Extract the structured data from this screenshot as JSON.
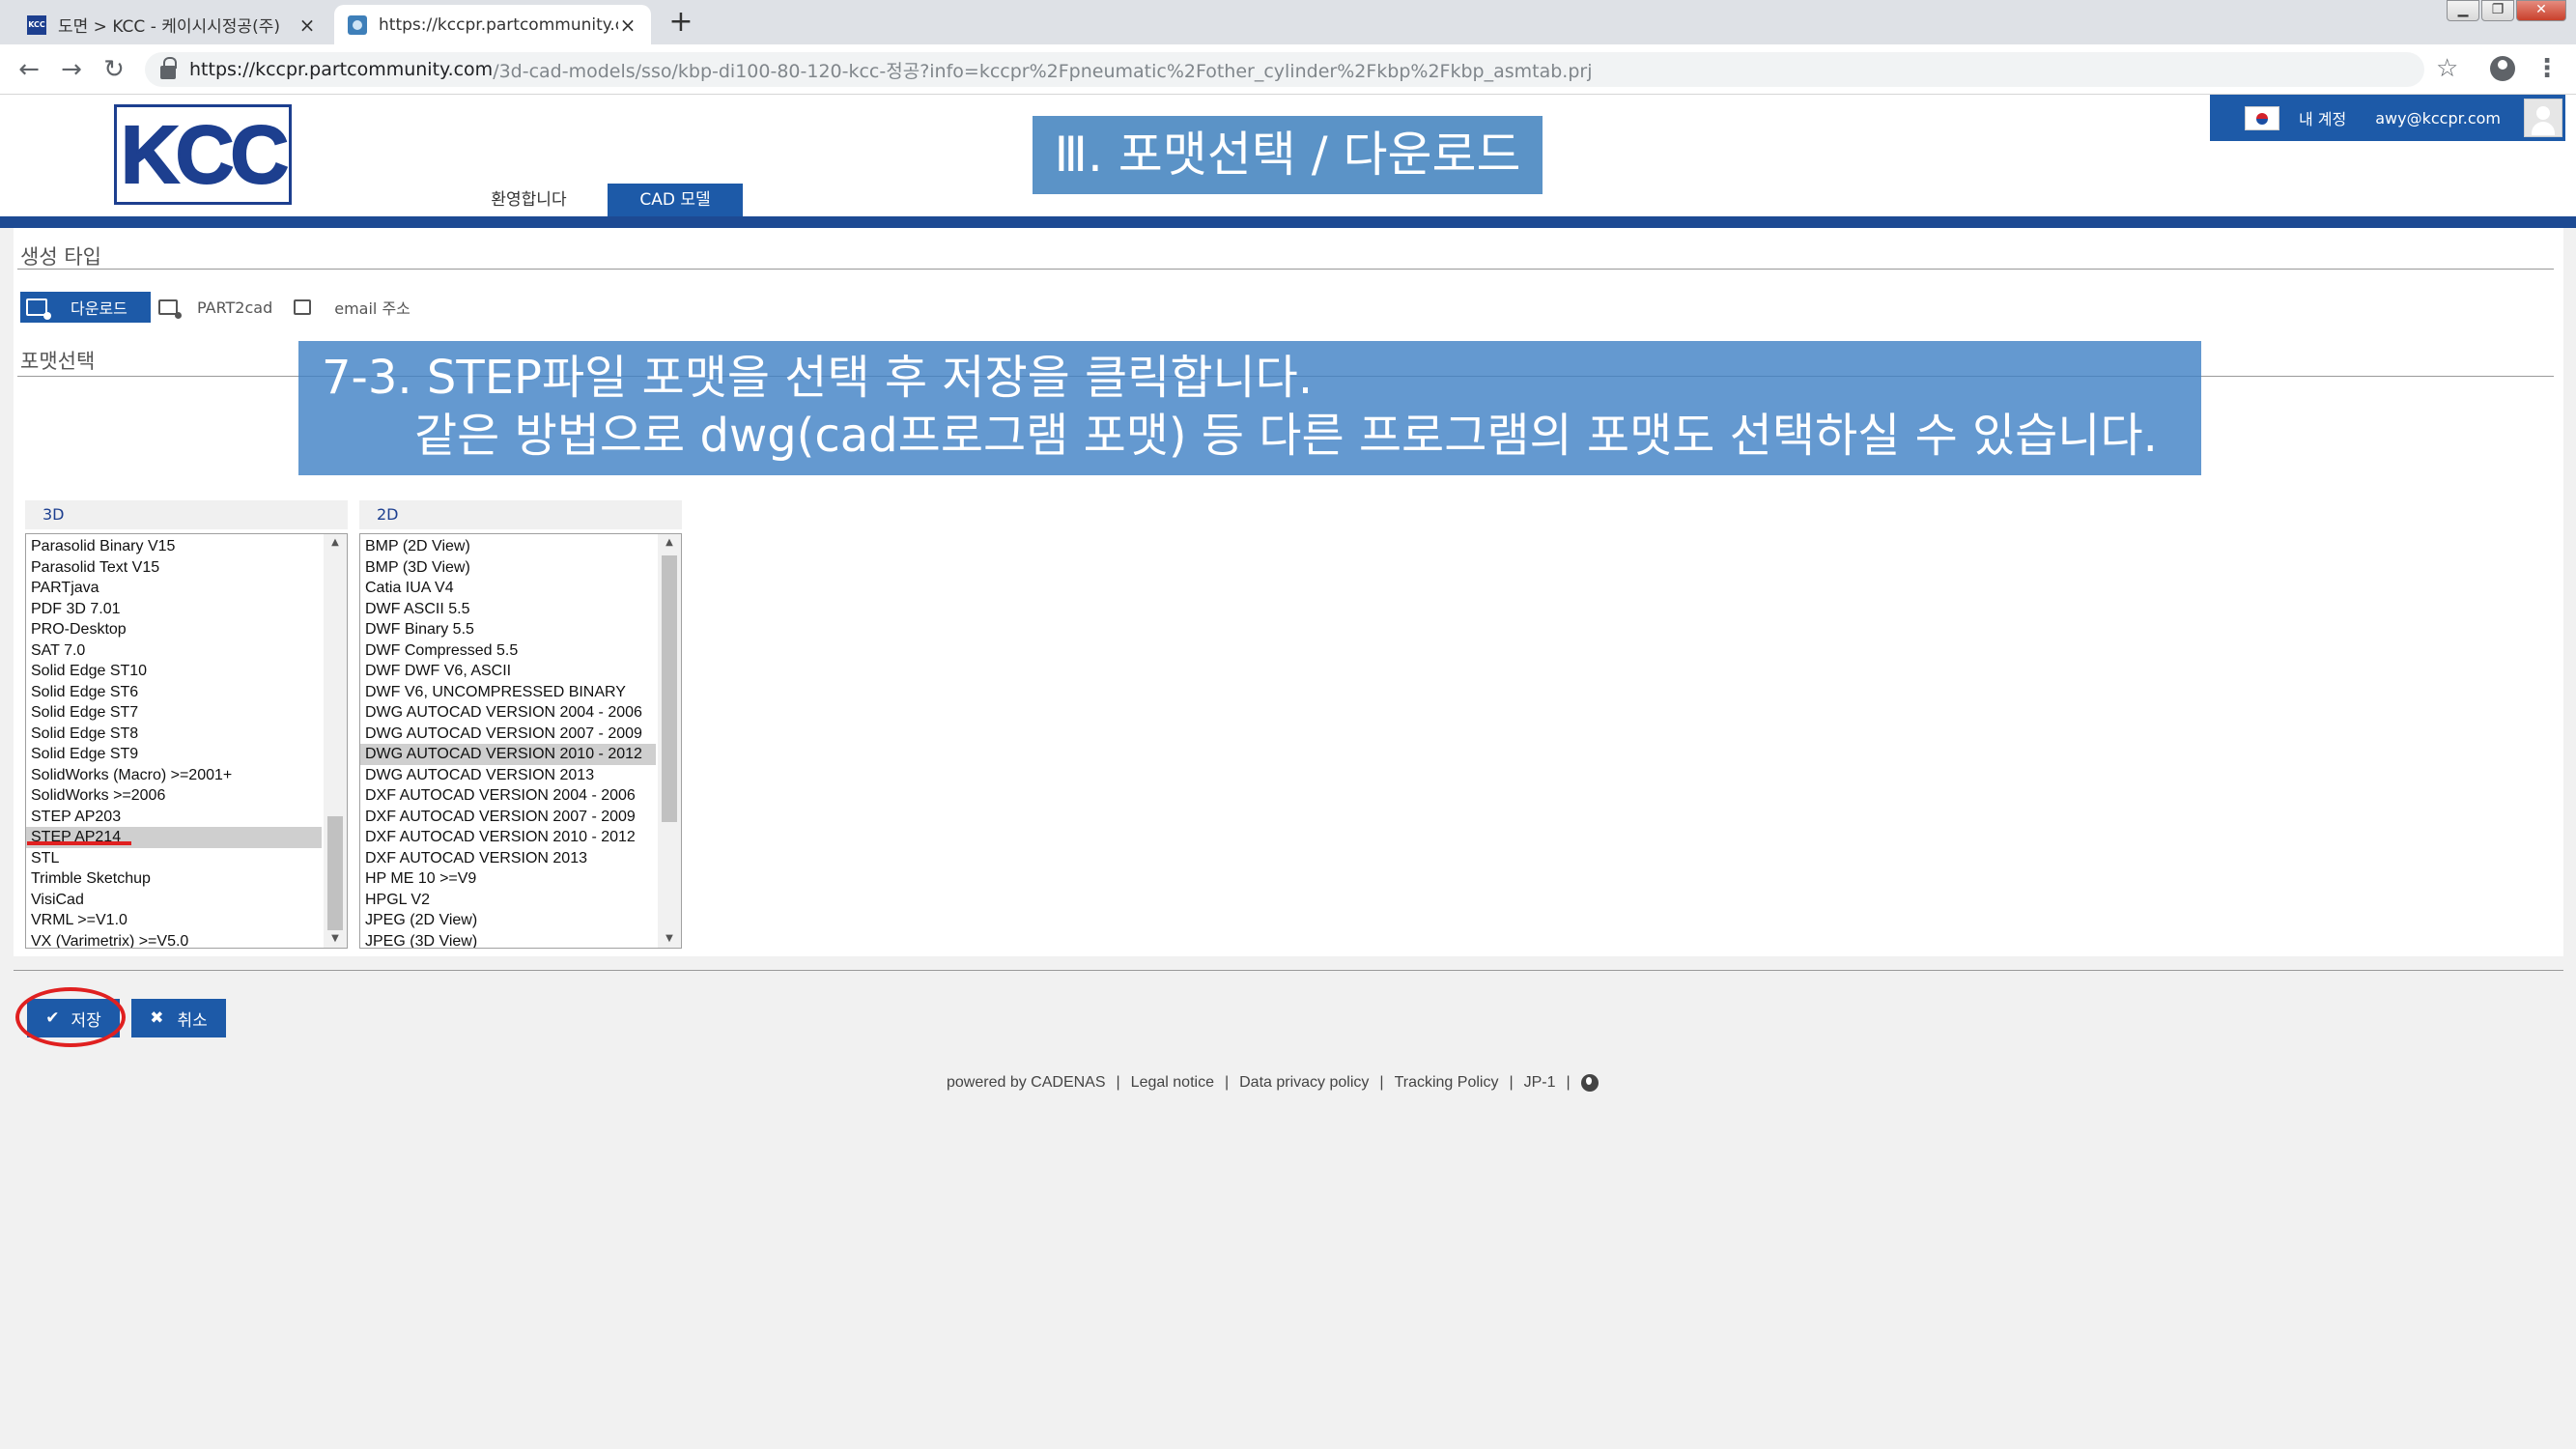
{
  "browser": {
    "tabs": [
      {
        "title": "도면 > KCC - 케이시시정공(주)",
        "active": false
      },
      {
        "title": "https://kccpr.partcommunity.co",
        "active": true
      }
    ],
    "new_tab": "+",
    "url_host": "https://kccpr.partcommunity.com",
    "url_path": "/3d-cad-models/sso/kbp-di100-80-120-kcc-정공?info=kccpr%2Fpneumatic%2Fother_cylinder%2Fkbp%2Fkbp_asmtab.prj"
  },
  "header": {
    "logo_text": "KCC",
    "nav": [
      "환영합니다",
      "CAD 모델"
    ],
    "title": "Ⅲ. 포맷선택 / 다운로드",
    "user": {
      "account": "내 계정",
      "email": "awy@kccpr.com"
    }
  },
  "form": {
    "generation_type_label": "생성 타입",
    "types": [
      "다운로드",
      "PART2cad",
      "email 주소"
    ],
    "format_label": "포맷선택",
    "list_3d": {
      "header": "3D",
      "items": [
        "Parasolid Binary V15",
        "Parasolid Text V15",
        "PARTjava",
        "PDF 3D 7.01",
        "PRO-Desktop",
        "SAT 7.0",
        "Solid Edge ST10",
        "Solid Edge ST6",
        "Solid Edge ST7",
        "Solid Edge ST8",
        "Solid Edge ST9",
        "SolidWorks (Macro) >=2001+",
        "SolidWorks >=2006",
        "STEP AP203",
        "STEP AP214",
        "STL",
        "Trimble Sketchup",
        "VisiCad",
        "VRML >=V1.0",
        "VX (Varimetrix) >=V5.0"
      ],
      "selected": "STEP AP214"
    },
    "list_2d": {
      "header": "2D",
      "items": [
        "BMP (2D View)",
        "BMP (3D View)",
        "Catia IUA V4",
        "DWF ASCII 5.5",
        "DWF Binary 5.5",
        "DWF Compressed 5.5",
        "DWF DWF V6, ASCII",
        "DWF V6, UNCOMPRESSED BINARY",
        "DWG AUTOCAD VERSION 2004 - 2006",
        "DWG AUTOCAD VERSION 2007 - 2009",
        "DWG AUTOCAD VERSION 2010 - 2012",
        "DWG AUTOCAD VERSION 2013",
        "DXF AUTOCAD VERSION 2004 - 2006",
        "DXF AUTOCAD VERSION 2007 - 2009",
        "DXF AUTOCAD VERSION 2010 - 2012",
        "DXF AUTOCAD VERSION 2013",
        "HP ME 10 >=V9",
        "HPGL V2",
        "JPEG (2D View)",
        "JPEG (3D View)"
      ],
      "selected": "DWG AUTOCAD VERSION 2010 - 2012"
    },
    "save_label": "저장",
    "cancel_label": "취소"
  },
  "overlay": {
    "line1": "7-3. STEP파일 포맷을 선택 후 저장을 클릭합니다.",
    "line2": "같은 방법으로 dwg(cad프로그램 포맷) 등 다른 프로그램의 포맷도 선택하실 수 있습니다."
  },
  "footer": {
    "links": [
      "powered by CADENAS",
      "Legal notice",
      "Data privacy policy",
      "Tracking Policy",
      "JP-1"
    ],
    "separator": "|"
  },
  "colors": {
    "brand_blue": "#1d5aa8",
    "header_rule": "#1d4a93",
    "overlay_blue": "#3d80c4",
    "annotation_red": "#e02020"
  }
}
